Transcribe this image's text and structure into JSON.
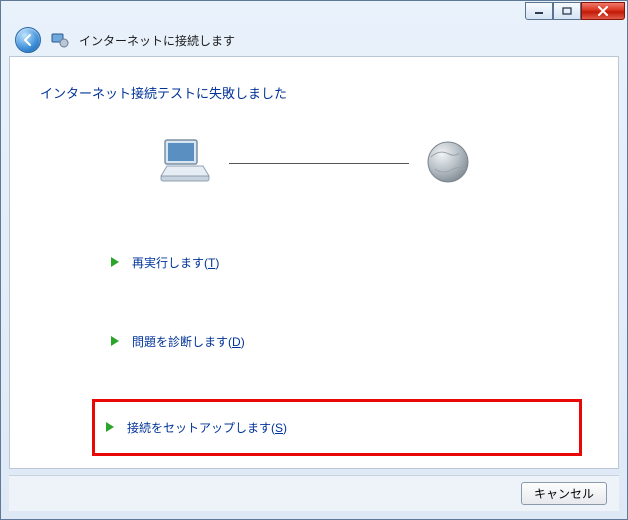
{
  "titlebar": {
    "minimize_name": "minimize",
    "maximize_name": "maximize",
    "close_name": "close"
  },
  "header": {
    "title": "インターネットに接続します"
  },
  "main": {
    "heading": "インターネット接続テストに失敗しました"
  },
  "options": {
    "retry": {
      "label": "再実行します",
      "accesskey": "T"
    },
    "diagnose": {
      "label": "問題を診断します",
      "accesskey": "D"
    },
    "setup": {
      "label": "接続をセットアップします",
      "accesskey": "S"
    }
  },
  "buttons": {
    "cancel": "キャンセル"
  }
}
